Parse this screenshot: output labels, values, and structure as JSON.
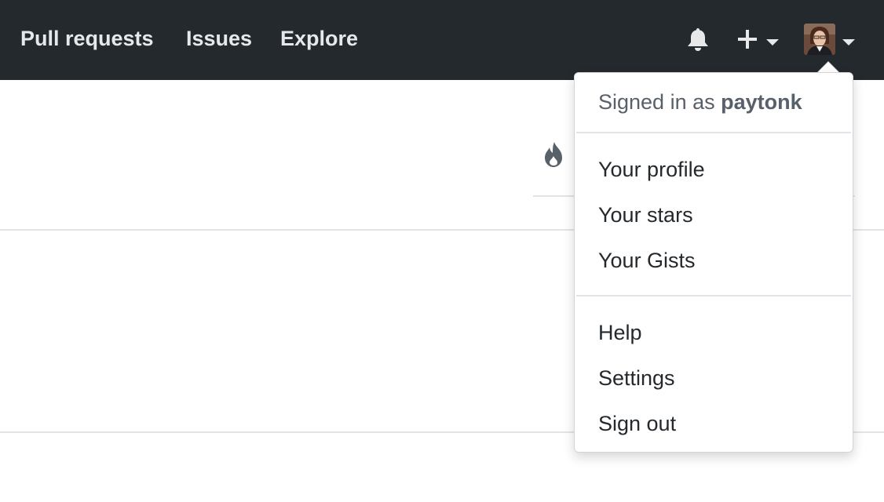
{
  "header": {
    "nav": [
      {
        "label": "Pull requests"
      },
      {
        "label": "Issues"
      },
      {
        "label": "Explore"
      }
    ],
    "icons": {
      "notifications": "bell-icon",
      "create": "plus-icon",
      "create_caret": "caret-down-icon",
      "avatar_caret": "caret-down-icon"
    }
  },
  "user_menu": {
    "signed_in_prefix": "Signed in as",
    "username": "paytonk",
    "section_1": [
      "Your profile",
      "Your stars",
      "Your Gists"
    ],
    "section_2": [
      "Help",
      "Settings",
      "Sign out"
    ]
  },
  "colors": {
    "header_bg": "#24292e",
    "header_text": "#e6e8ea",
    "muted_text": "#586069",
    "body_text": "#24292e"
  }
}
